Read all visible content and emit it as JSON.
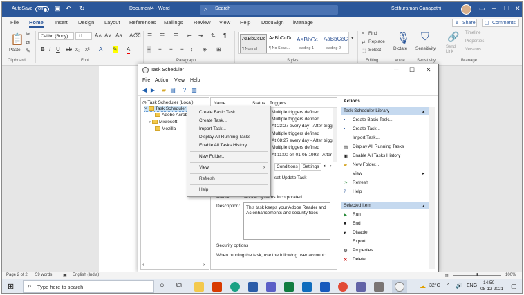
{
  "word": {
    "autosave_label": "AutoSave",
    "autosave_state": "Off",
    "doc_title": "Document4 - Word",
    "search_placeholder": "Search",
    "user_name": "Sethuraman Ganapathi",
    "tabs": [
      "File",
      "Home",
      "Insert",
      "Design",
      "Layout",
      "References",
      "Mailings",
      "Review",
      "View",
      "Help",
      "DocuSign",
      "iManage"
    ],
    "active_tab": "Home",
    "share_label": "Share",
    "comments_label": "Comments",
    "ribbon": {
      "paste_label": "Paste",
      "font_name": "Calibri (Body)",
      "font_size": "11",
      "groups": [
        "Clipboard",
        "Font",
        "Paragraph",
        "Styles",
        "Editing",
        "Voice",
        "Sensitivity",
        "iManage"
      ],
      "styles": [
        {
          "sample": "AaBbCcDc",
          "name": "¶ Normal"
        },
        {
          "sample": "AaBbCcDc",
          "name": "¶ No Spac..."
        },
        {
          "sample": "AaBbCc",
          "name": "Heading 1"
        },
        {
          "sample": "AaBbCcC",
          "name": "Heading 2"
        }
      ],
      "editing": [
        "Find",
        "Replace",
        "Select"
      ],
      "dictate_label": "Dictate",
      "sensitivity_label": "Sensitivity",
      "imanage_items": [
        "Send Link",
        "Timeline",
        "Properties",
        "Versions"
      ]
    },
    "status": {
      "page": "Page 2 of 2",
      "words": "59 words",
      "language": "English (India)",
      "zoom": "100%"
    }
  },
  "task_scheduler": {
    "title": "Task Scheduler",
    "menu": [
      "File",
      "Action",
      "View",
      "Help"
    ],
    "tree": {
      "root": "Task Scheduler (Local)",
      "library": "Task Scheduler Library",
      "children": [
        "Adobe Acrobat",
        "Microsoft",
        "Mozilla"
      ]
    },
    "columns": [
      "Name",
      "Status",
      "Triggers"
    ],
    "triggers": [
      "Multiple triggers defined",
      "Multiple triggers defined",
      "At 23:27 every day - After trigge",
      "Multiple triggers defined",
      "At 08:27 every day - After trigge",
      "Multiple triggers defined",
      "At 11:00 on 01-05-1992 - After t"
    ],
    "detail_tabs": [
      "Conditions",
      "Settings"
    ],
    "detail_name": "set Update Task",
    "author_label": "Author:",
    "author_value": "Adobe Systems Incorporated",
    "description_label": "Description:",
    "description_value": "This task keeps your Adobe Reader and Ac enhancements and security fixes",
    "security_options_label": "Security options",
    "security_text": "When running the task, use the following user account:",
    "actions_header": "Actions",
    "library_section": "Task Scheduler Library",
    "library_actions": [
      "Create Basic Task...",
      "Create Task...",
      "Import Task...",
      "Display All Running Tasks",
      "Enable All Tasks History",
      "New Folder...",
      "View",
      "Refresh",
      "Help"
    ],
    "selected_section": "Selected Item",
    "selected_actions": [
      "Run",
      "End",
      "Disable",
      "Export...",
      "Properties",
      "Delete"
    ]
  },
  "context_menu": {
    "items": [
      "Create Basic Task...",
      "Create Task...",
      "Import Task...",
      "Display All Running Tasks",
      "Enable All Tasks History",
      "New Folder...",
      "View",
      "Refresh",
      "Help"
    ]
  },
  "taskbar": {
    "search_placeholder": "Type here to search",
    "temperature": "32°C",
    "language": "ENG",
    "time": "14:50",
    "date": "08-12-2021"
  },
  "colors": {
    "word_blue": "#2b579a",
    "selection_blue": "#c5d9ef",
    "taskbar": "#e3e9f1"
  }
}
